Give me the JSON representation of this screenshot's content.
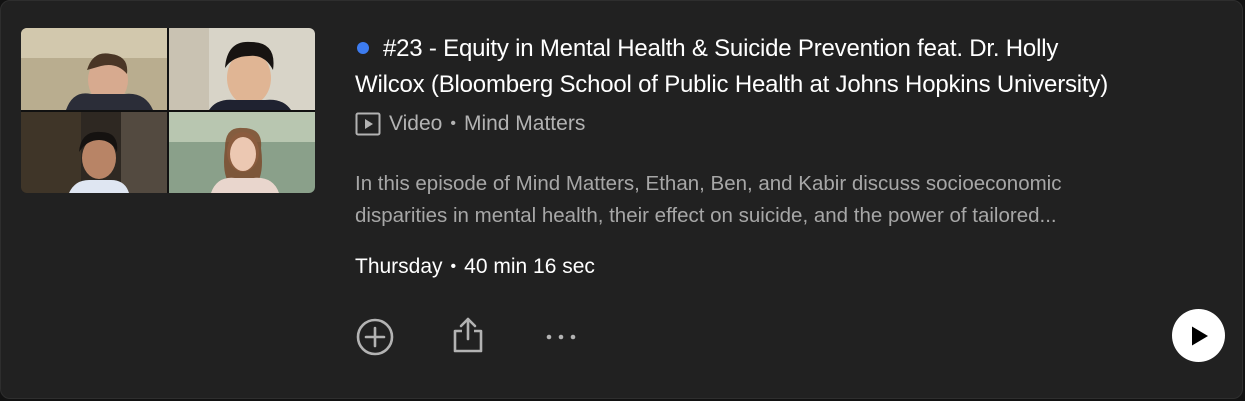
{
  "episode": {
    "is_new": true,
    "title_line1": "#23 - Equity in Mental Health & Suicide Prevention feat. Dr. Holly",
    "title_line2": "Wilcox (Bloomberg School of Public Health at Johns Hopkins University)",
    "media_type": "Video",
    "show_name": "Mind Matters",
    "description_line1": "In this episode of Mind Matters, Ethan, Ben, and Kabir discuss socioeconomic",
    "description_line2": "disparities in mental health, their effect on suicide, and the power of tailored...",
    "release_day": "Thursday",
    "duration": "40 min 16 sec",
    "separator": "•"
  },
  "thumbnail": {
    "description": "four-person video call grid",
    "icon": "video-thumbnail"
  },
  "actions": {
    "add_icon": "plus-circle-icon",
    "share_icon": "share-icon",
    "more_icon": "more-icon",
    "play_icon": "play-icon"
  },
  "colors": {
    "background": "#212121",
    "new_dot": "#3d7cf0",
    "text_primary": "#ffffff",
    "text_secondary": "#a7a7a7",
    "play_button": "#ffffff"
  }
}
